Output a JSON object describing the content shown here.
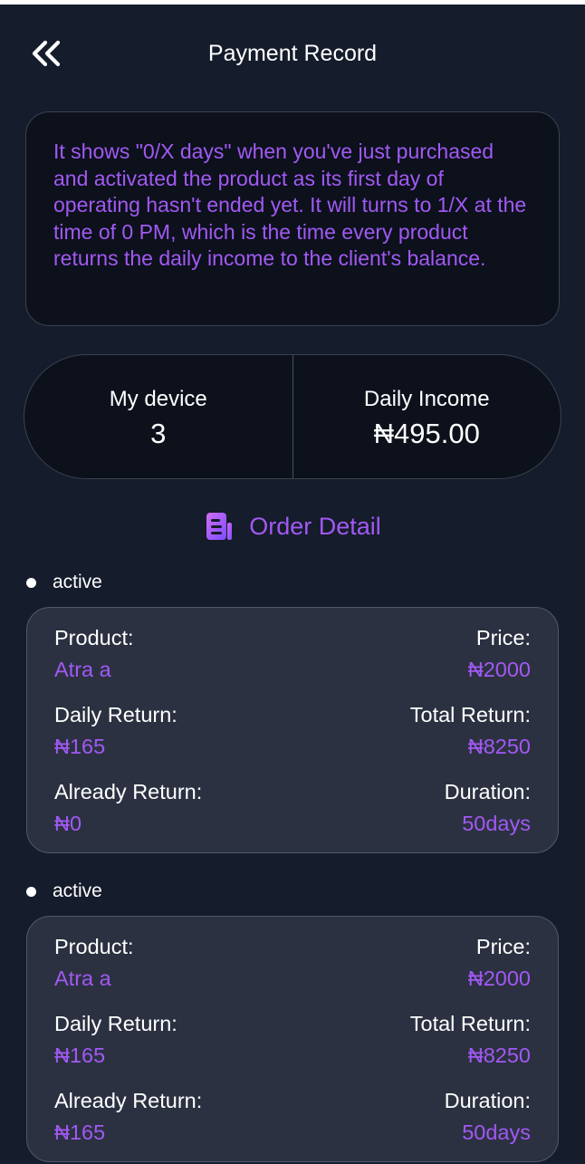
{
  "header": {
    "title": "Payment Record",
    "back_icon": "double-chevron-left-icon"
  },
  "notice": {
    "text": "It shows \"0/X days\" when you've just purchased and activated the product as its first day of operating hasn't ended yet. It will turns to 1/X at the time of 0 PM, which is the time every product returns the daily income to the client's balance."
  },
  "stats": {
    "device_label": "My device",
    "device_value": "3",
    "income_label": "Daily Income",
    "income_value": "₦495.00"
  },
  "order_detail": {
    "label": "Order Detail",
    "icon": "document-icon"
  },
  "colors": {
    "background": "#151c2b",
    "accent": "#a259f3",
    "card": "#2b3141",
    "panel": "#0c111c"
  },
  "orders": [
    {
      "status": "active",
      "product_label": "Product:",
      "product": "Atra a",
      "price_label": "Price:",
      "price": "₦2000",
      "daily_return_label": "Daily Return:",
      "daily_return": "₦165",
      "total_return_label": "Total Return:",
      "total_return": "₦8250",
      "already_return_label": "Already Return:",
      "already_return": "₦0",
      "duration_label": "Duration:",
      "duration": "50days"
    },
    {
      "status": "active",
      "product_label": "Product:",
      "product": "Atra a",
      "price_label": "Price:",
      "price": "₦2000",
      "daily_return_label": "Daily Return:",
      "daily_return": "₦165",
      "total_return_label": "Total Return:",
      "total_return": "₦8250",
      "already_return_label": "Already Return:",
      "already_return": "₦165",
      "duration_label": "Duration:",
      "duration": "50days"
    }
  ]
}
